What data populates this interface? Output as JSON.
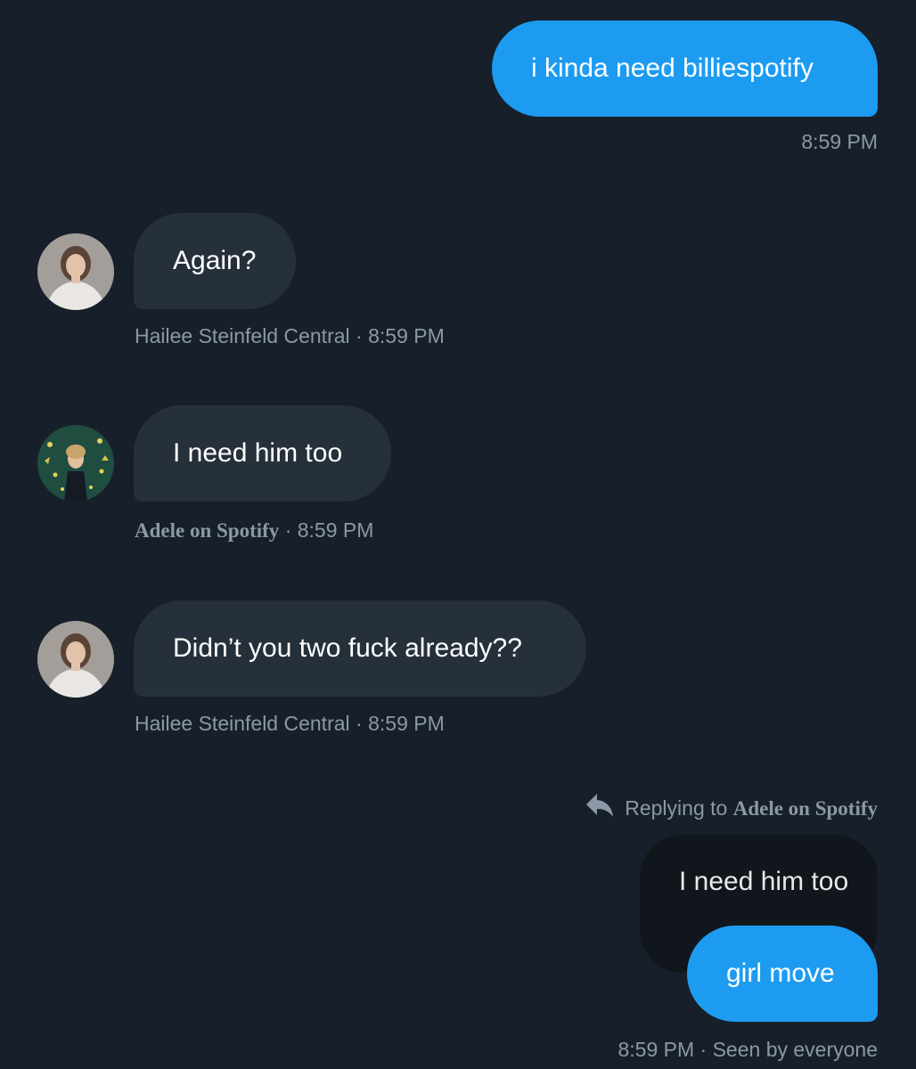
{
  "messages": [
    {
      "direction": "sent",
      "text": "i kinda need billiespotify",
      "time": "8:59 PM"
    },
    {
      "direction": "received",
      "text": "Again?",
      "sender": "Hailee Steinfeld Central",
      "separator": "·",
      "time": "8:59 PM",
      "avatar": "hailee-avatar"
    },
    {
      "direction": "received",
      "text": "I need him too",
      "sender": "Adele on Spotify",
      "separator": "·",
      "time": "8:59 PM",
      "avatar": "adele-avatar"
    },
    {
      "direction": "received",
      "text": "Didn’t you two fuck already??",
      "sender": "Hailee Steinfeld Central",
      "separator": "·",
      "time": "8:59 PM",
      "avatar": "hailee-avatar"
    },
    {
      "direction": "sent",
      "reply_prefix": "Replying to",
      "reply_to": "Adele on Spotify",
      "reply_icon": "reply-arrow-icon",
      "quoted_text": "I need him too",
      "text": "girl move",
      "time": "8:59 PM",
      "separator": "·",
      "status": "Seen by everyone"
    }
  ],
  "colors": {
    "background": "#17202a",
    "sent_bubble": "#1d9bf0",
    "received_bubble": "#26303a",
    "quoted_bubble": "#10161c",
    "meta_text": "#8b98a5"
  }
}
